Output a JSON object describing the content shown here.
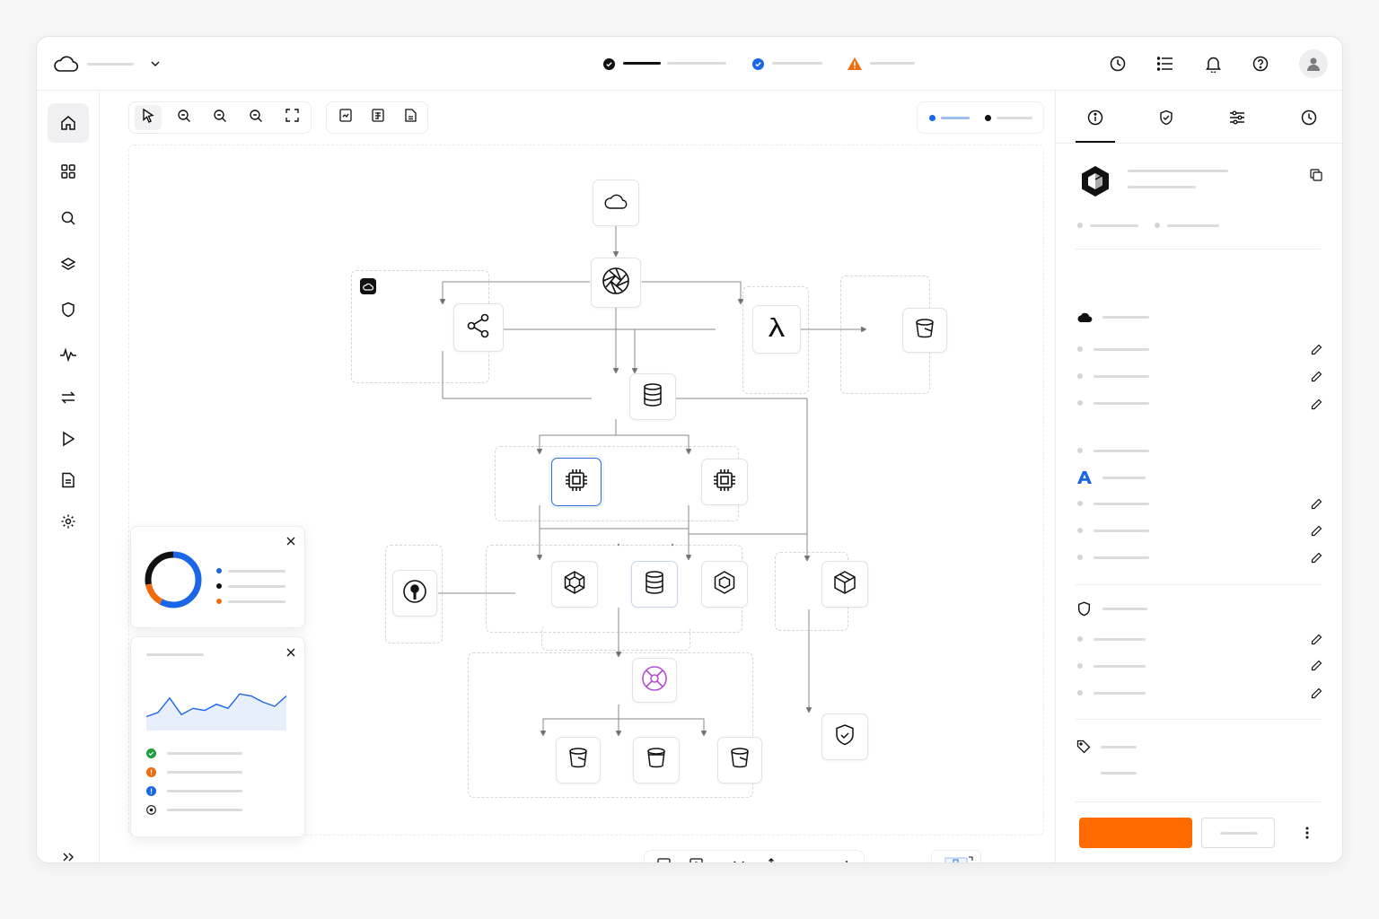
{
  "colors": {
    "accent_orange": "#ff6a00",
    "accent_blue": "#1a66e6",
    "warning_orange": "#f06a10",
    "success_green": "#1e9e3e",
    "purple": "#b44fd1",
    "dark": "#111111"
  },
  "topbar": {
    "logo_icon": "cloud-icon",
    "menu_icon": "chevron-down-icon",
    "steps": [
      {
        "icon": "check-circle-icon",
        "state": "complete"
      },
      {
        "icon": "check-circle-blue-icon",
        "state": "active"
      },
      {
        "icon": "warning-triangle-icon",
        "state": "warning"
      }
    ],
    "actions": [
      "history-icon",
      "list-icon",
      "bell-icon",
      "help-icon",
      "avatar"
    ]
  },
  "sidebar": {
    "items": [
      {
        "icon": "home-icon",
        "active": true
      },
      {
        "icon": "grid-icon",
        "active": false
      },
      {
        "icon": "search-icon",
        "active": false
      },
      {
        "icon": "layers-icon",
        "active": false
      },
      {
        "icon": "shield-icon",
        "active": false
      },
      {
        "icon": "activity-icon",
        "active": false
      },
      {
        "icon": "transfer-icon",
        "active": false
      },
      {
        "icon": "play-icon",
        "active": false
      },
      {
        "icon": "document-icon",
        "active": false
      },
      {
        "icon": "settings-icon",
        "active": false
      }
    ],
    "expand_icon": "double-chevron-right-icon"
  },
  "canvas": {
    "toolbar_left": [
      "pointer-icon",
      "zoom-in-icon",
      "zoom-out-icon",
      "zoom-reset-icon",
      "fit-screen-icon"
    ],
    "toolbar_mid": [
      "export-image-icon",
      "export-json-icon",
      "export-doc-icon"
    ],
    "nodes": [
      {
        "id": "cloud",
        "icon": "cloud-icon"
      },
      {
        "id": "gateway",
        "icon": "aperture-icon"
      },
      {
        "id": "share",
        "icon": "share-icon"
      },
      {
        "id": "lambda",
        "icon": "lambda-icon"
      },
      {
        "id": "bucket-top",
        "icon": "bucket-icon"
      },
      {
        "id": "db-main",
        "icon": "database-icon"
      },
      {
        "id": "cpu-left",
        "icon": "chip-icon"
      },
      {
        "id": "cpu-right",
        "icon": "chip-icon"
      },
      {
        "id": "key",
        "icon": "key-icon"
      },
      {
        "id": "hex-left",
        "icon": "hexagon-icon"
      },
      {
        "id": "db-mid",
        "icon": "database-icon"
      },
      {
        "id": "hex-right",
        "icon": "hexagon-icon"
      },
      {
        "id": "box",
        "icon": "box-icon"
      },
      {
        "id": "event-hub",
        "icon": "event-icon"
      },
      {
        "id": "bucket-1",
        "icon": "bucket-icon"
      },
      {
        "id": "bucket-2",
        "icon": "bucket-icon"
      },
      {
        "id": "bucket-3",
        "icon": "bucket-icon"
      },
      {
        "id": "guard",
        "icon": "shield-check-icon"
      }
    ],
    "bottom_toolbar": [
      "image-export-icon",
      "snapshot-icon",
      "code-toggle-icon",
      "share-out-icon",
      "minus-icon",
      "plus-icon"
    ],
    "minimap_icon": "minimap-icon"
  },
  "widgets": {
    "donut": {
      "close_icon": "close-icon",
      "segments": [
        {
          "color": "#1a66e6",
          "share": 0.58
        },
        {
          "color": "#f06a10",
          "share": 0.14
        },
        {
          "color": "#111111",
          "share": 0.28
        }
      ]
    },
    "activity": {
      "close_icon": "close-icon",
      "trend": [
        0.25,
        0.35,
        0.7,
        0.3,
        0.45,
        0.4,
        0.55,
        0.45,
        0.8,
        0.75,
        0.6,
        0.5,
        0.75
      ],
      "statuses": [
        "success-icon",
        "warning-icon",
        "info-icon",
        "pending-icon"
      ]
    }
  },
  "rightpanel": {
    "tabs": [
      "info-icon",
      "shield-tab-icon",
      "sliders-icon",
      "clock-tab-icon"
    ],
    "resource_icon": "resource-hex-icon",
    "copy_icon": "copy-icon",
    "sections": [
      {
        "icon": "cloud-solid-icon"
      },
      {
        "icon": "azure-icon"
      },
      {
        "icon": "shield-outline-icon"
      },
      {
        "icon": "tag-icon"
      }
    ],
    "edit_icon": "pencil-icon",
    "more_icon": "kebab-icon"
  }
}
